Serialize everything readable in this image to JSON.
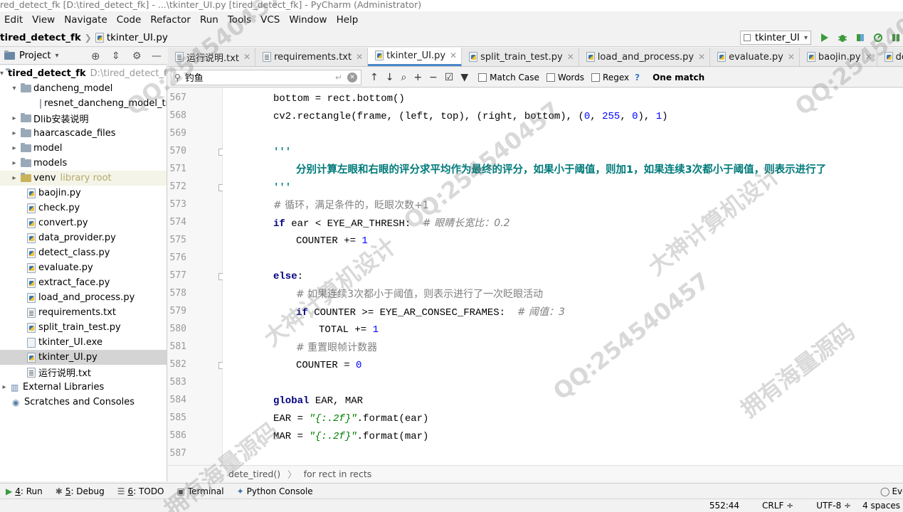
{
  "window": {
    "title": "red_detect_fk [D:\\tired_detect_fk] - ...\\tkinter_UI.py [tired_detect_fk] - PyCharm (Administrator)"
  },
  "menu": [
    "Edit",
    "View",
    "Navigate",
    "Code",
    "Refactor",
    "Run",
    "Tools",
    "VCS",
    "Window",
    "Help"
  ],
  "nav": {
    "project": "tired_detect_fk",
    "file": "tkinter_UI.py",
    "run_config": "tkinter_UI"
  },
  "project_panel": {
    "label": "Project"
  },
  "tree": [
    {
      "label": "tired_detect_fk",
      "extra": "D:\\tired_detect_fk",
      "type": "root"
    },
    {
      "label": "dancheng_model",
      "type": "folder-open"
    },
    {
      "label": "resnet_dancheng_model_tra",
      "type": "file"
    },
    {
      "label": "Dlib安装说明",
      "type": "folder"
    },
    {
      "label": "haarcascade_files",
      "type": "folder"
    },
    {
      "label": "model",
      "type": "folder"
    },
    {
      "label": "models",
      "type": "folder"
    },
    {
      "label": "venv",
      "extra": "library root",
      "type": "folder"
    },
    {
      "label": "baojin.py",
      "type": "py"
    },
    {
      "label": "check.py",
      "type": "py"
    },
    {
      "label": "convert.py",
      "type": "py"
    },
    {
      "label": "data_provider.py",
      "type": "py"
    },
    {
      "label": "detect_class.py",
      "type": "py"
    },
    {
      "label": "evaluate.py",
      "type": "py"
    },
    {
      "label": "extract_face.py",
      "type": "py"
    },
    {
      "label": "load_and_process.py",
      "type": "py"
    },
    {
      "label": "requirements.txt",
      "type": "txt"
    },
    {
      "label": "split_train_test.py",
      "type": "py"
    },
    {
      "label": "tkinter_UI.exe",
      "type": "file"
    },
    {
      "label": "tkinter_UI.py",
      "type": "py"
    },
    {
      "label": "运行说明.txt",
      "type": "txt"
    },
    {
      "label": "External Libraries",
      "type": "lib"
    },
    {
      "label": "Scratches and Consoles",
      "type": "scratch"
    }
  ],
  "tabs": [
    "运行说明.txt",
    "requirements.txt",
    "tkinter_UI.py",
    "split_train_test.py",
    "load_and_process.py",
    "evaluate.py",
    "baojin.py",
    "detect_class.py"
  ],
  "find": {
    "query": "钓鱼",
    "match_case": "Match Case",
    "words": "Words",
    "regex": "Regex",
    "help": "?",
    "result": "One match"
  },
  "line_numbers": [
    "567",
    "568",
    "569",
    "570",
    "571",
    "572",
    "573",
    "574",
    "575",
    "576",
    "577",
    "578",
    "579",
    "580",
    "581",
    "582",
    "583",
    "584",
    "585",
    "586",
    "587"
  ],
  "code": {
    "l567": "bottom = rect.bottom()",
    "l568a": "cv2.rectangle(frame, (left, top), (right, bottom), (",
    "l568n1": "0",
    "l568c1": ", ",
    "l568n2": "255",
    "l568c2": ", ",
    "l568n3": "0",
    "l568c3": "), ",
    "l568n4": "1",
    "l568e": ")",
    "l570": "'''",
    "l571": "分别计算左眼和右眼的评分求平均作为最终的评分，如果小于阈值，则加1，如果连续3次都小于阈值，则表示进行了",
    "l572": "'''",
    "l573": "# 循环，满足条件的，眨眼次数+1",
    "l574kw": "if",
    "l574": " ear < EYE_AR_THRESH:  ",
    "l574c": "# 眼睛长宽比：0.2",
    "l575": "COUNTER += ",
    "l575n": "1",
    "l577kw": "else",
    "l577": ":",
    "l578": "# 如果连续3次都小于阈值，则表示进行了一次眨眼活动",
    "l579kw": "if",
    "l579": " COUNTER >= EYE_AR_CONSEC_FRAMES:  ",
    "l579c": "# 阈值：3",
    "l580": "TOTAL += ",
    "l580n": "1",
    "l581": "# 重置眼帧计数器",
    "l582": "COUNTER = ",
    "l582n": "0",
    "l584kw": "global",
    "l584": " EAR, MAR",
    "l585a": "EAR = ",
    "l585s": "\"{:.2f}\"",
    "l585b": ".format(ear)",
    "l586a": "MAR = ",
    "l586s": "\"{:.2f}\"",
    "l586b": ".format(mar)"
  },
  "breadcrumb": [
    "dete_tired()",
    "for rect in rects"
  ],
  "toolwindows": [
    {
      "num": "4",
      "label": ": Run"
    },
    {
      "num": "5",
      "label": ": Debug"
    },
    {
      "num": "6",
      "label": ": TODO"
    },
    {
      "num": "",
      "label": "Terminal"
    },
    {
      "num": "",
      "label": "Python Console"
    }
  ],
  "event_log": "Eve",
  "status": {
    "position": "552:44",
    "line_sep": "CRLF",
    "encoding": "UTF-8",
    "indent": "4 spaces"
  },
  "watermarks": [
    "QQ:254540457",
    "大神计算机设计",
    "拥有海量源码"
  ],
  "colors": {
    "keyword": "#000080",
    "string": "#008080",
    "number": "#0000ff",
    "comment": "#808080",
    "selection": "#d4d4d4",
    "tab_accent": "#4a88c7"
  }
}
